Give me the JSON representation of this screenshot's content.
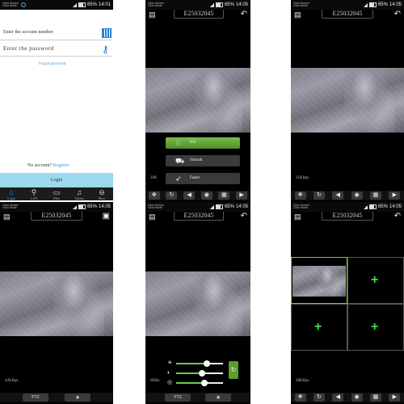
{
  "statusbar": {
    "note_line1": "Glow Screen",
    "note_line2": "Glow Mode",
    "battery_pct": "65%",
    "time": "14:05",
    "time_first": "14:01"
  },
  "device_id": "E25032045",
  "login": {
    "account_placeholder": "Enter the account number",
    "password_placeholder": "Enter the password",
    "forgot": "Forgot password",
    "no_account": "No account?",
    "register": "Register",
    "login_button": "Login",
    "tabs": [
      "Login",
      "LAN",
      "Files",
      "Alarms",
      "More"
    ]
  },
  "quality": {
    "options": [
      "HD",
      "Smooth",
      "Faster"
    ],
    "selected": "HD",
    "rate": "20K"
  },
  "rates": {
    "panel3": "21KBps",
    "panel4": "42KBps",
    "panel5": "0KBs",
    "panel6": "38KBps"
  },
  "ptz_label": "PTZ",
  "image_settings": {
    "brightness": 0.65,
    "contrast": 0.55,
    "saturation": 0.6
  },
  "toolbar_icons": [
    "ptz-icon",
    "rotate-icon",
    "speaker-icon",
    "camera-icon",
    "grid-icon",
    "record-icon"
  ],
  "colors": {
    "accent_green": "#5fd34a",
    "link_blue": "#37a0e0",
    "login_bar": "#9cd8ee"
  }
}
